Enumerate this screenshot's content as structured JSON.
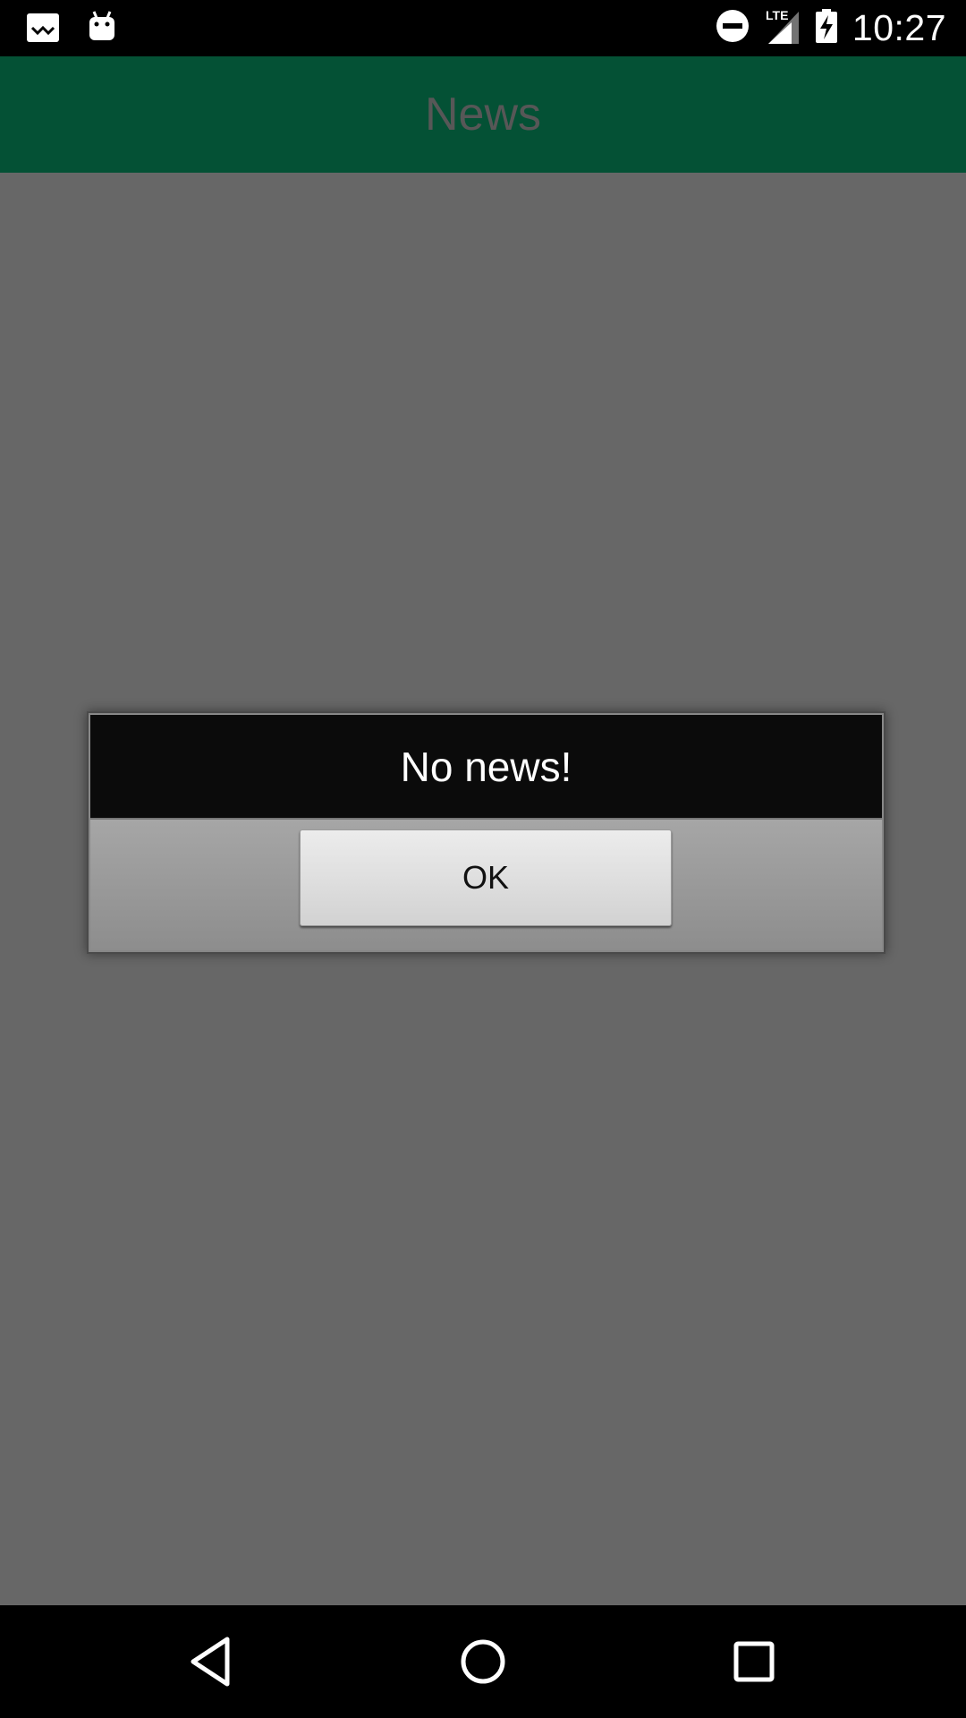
{
  "status_bar": {
    "time": "10:27",
    "network_type": "LTE",
    "icons": [
      "notification-app-icon",
      "android-icon",
      "do-not-disturb-icon",
      "signal-icon",
      "battery-charging-icon"
    ]
  },
  "app_bar": {
    "title": "News",
    "color": "#045135"
  },
  "dialog": {
    "message": "No news!",
    "ok_label": "OK"
  },
  "nav_bar": {
    "icons": [
      "back-icon",
      "home-icon",
      "recents-icon"
    ]
  }
}
